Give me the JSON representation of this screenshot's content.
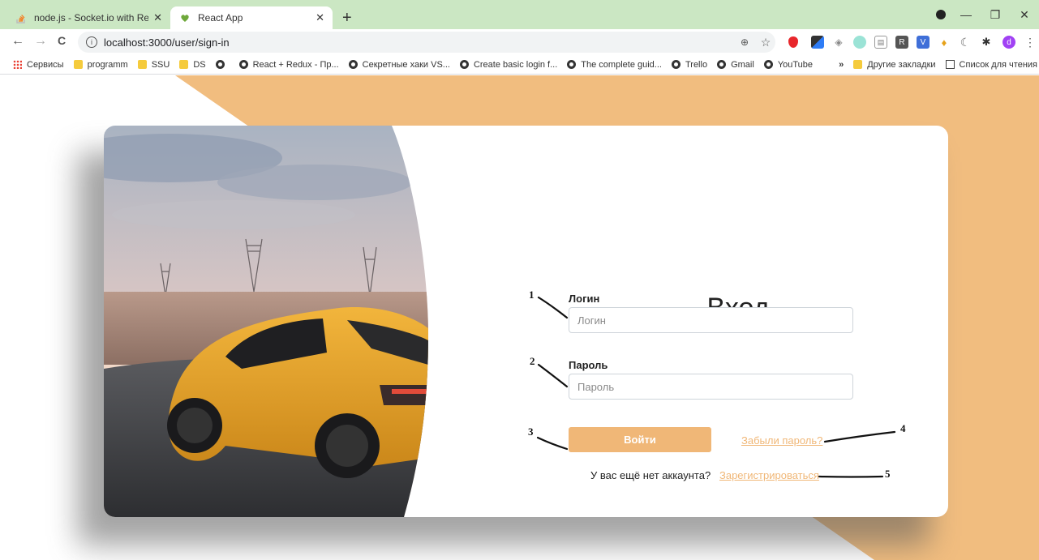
{
  "browser": {
    "tabs": [
      {
        "title": "node.js - Socket.io with React be",
        "active": false,
        "icon": "stackoverflow-icon"
      },
      {
        "title": "React App",
        "active": true,
        "icon": "react-icon"
      }
    ],
    "new_tab": "+",
    "window_controls": {
      "minimize": "—",
      "maximize": "❐",
      "close": "✕"
    },
    "nav": {
      "back": "←",
      "forward": "→",
      "reload": "C"
    },
    "url": "localhost:3000/user/sign-in",
    "bookmarks": [
      {
        "label": "Сервисы",
        "type": "apps"
      },
      {
        "label": "programm",
        "type": "folder"
      },
      {
        "label": "SSU",
        "type": "folder"
      },
      {
        "label": "DS",
        "type": "folder"
      },
      {
        "label": "",
        "type": "globe"
      },
      {
        "label": "React + Redux - Пр...",
        "type": "globe"
      },
      {
        "label": "Секретные хаки VS...",
        "type": "globe"
      },
      {
        "label": "Create basic login f...",
        "type": "globe"
      },
      {
        "label": "The complete guid...",
        "type": "globe"
      },
      {
        "label": "Trello",
        "type": "globe"
      },
      {
        "label": "Gmail",
        "type": "globe"
      },
      {
        "label": "YouTube",
        "type": "globe"
      }
    ],
    "bookmarks_more": "»",
    "other_bookmarks": "Другие закладки",
    "reading_list": "Список для чтения",
    "profile_letter": "d"
  },
  "colors": {
    "accent": "#f0b777",
    "tabbar": "#cbe7c3",
    "background_shape": "#f1bd7f"
  },
  "form": {
    "title": "Вход",
    "login_label": "Логин",
    "login_placeholder": "Логин",
    "password_label": "Пароль",
    "password_placeholder": "Пароль",
    "submit": "Войти",
    "forgot": "Забыли пароль?",
    "no_account": "У вас ещё нет аккаунта?",
    "register": "Зарегистрироваться"
  },
  "annotations": [
    "1",
    "2",
    "3",
    "4",
    "5"
  ]
}
